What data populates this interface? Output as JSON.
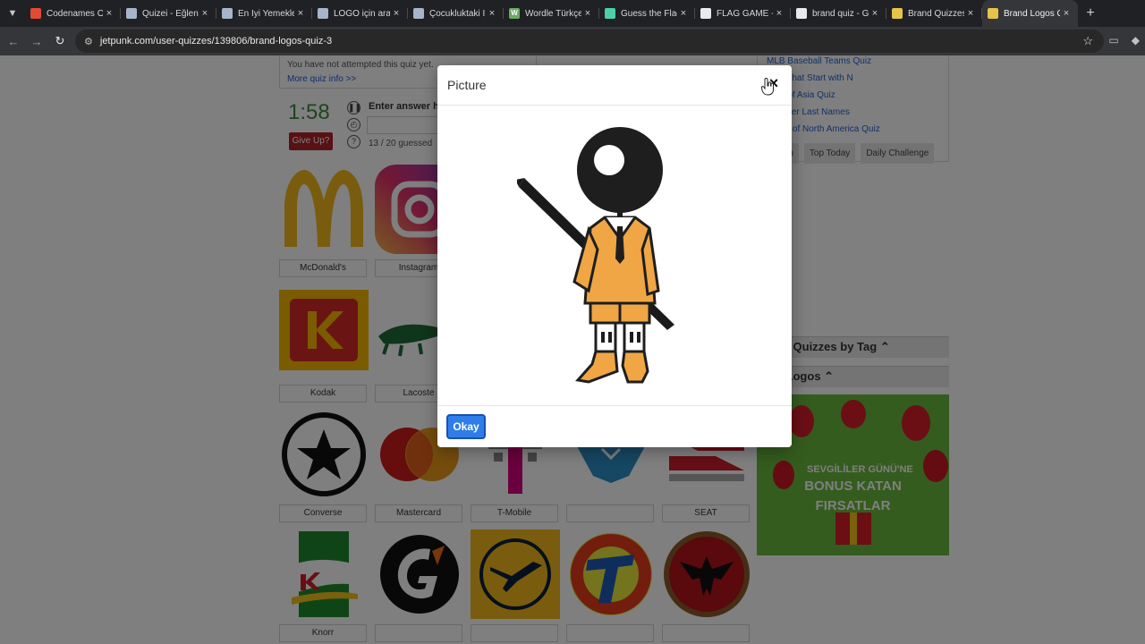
{
  "browser": {
    "tabs": [
      {
        "title": "Codenames O",
        "favicon_color": "#e34a33",
        "active": false
      },
      {
        "title": "Quizei - Eğlenc",
        "favicon_color": "#a6b5c9",
        "active": false
      },
      {
        "title": "En İyi Yemekle",
        "favicon_color": "#a6b5c9",
        "active": false
      },
      {
        "title": "LOGO için aran",
        "favicon_color": "#a6b5c9",
        "active": false
      },
      {
        "title": "Çocukluktaki İ",
        "favicon_color": "#a6b5c9",
        "active": false
      },
      {
        "title": "Wordle Türkçe",
        "favicon_color": "#6aaa64",
        "favicon_letter": "W",
        "active": false
      },
      {
        "title": "Guess the Flag",
        "favicon_color": "#4dd0a6",
        "active": false
      },
      {
        "title": "FLAG GAME - ",
        "favicon_color": "#e8eaed",
        "active": false
      },
      {
        "title": "brand quiz - G",
        "favicon_color": "#e8eaed",
        "active": false
      },
      {
        "title": "Brand Quizzes",
        "favicon_color": "#e6c34a",
        "active": false
      },
      {
        "title": "Brand Logos Q",
        "favicon_color": "#e6c34a",
        "active": true
      }
    ],
    "url": "jetpunk.com/user-quizzes/139806/brand-logos-quiz-3"
  },
  "quiz": {
    "not_attempted": "You have not attempted this quiz yet.",
    "more_info": "More quiz info >>",
    "timer": "1:58",
    "give_up": "Give Up?",
    "answer_label": "Enter answer h",
    "guessed": "13 / 20 guessed",
    "logos": [
      {
        "label": "McDonald's",
        "icon": "mcdonalds-logo"
      },
      {
        "label": "Instagram",
        "icon": "instagram-logo"
      },
      {
        "label": "Kodak",
        "icon": "kodak-logo"
      },
      {
        "label": "Lacoste",
        "icon": "lacoste-logo"
      },
      {
        "label": "Converse",
        "icon": "converse-logo"
      },
      {
        "label": "Mastercard",
        "icon": "mastercard-logo"
      },
      {
        "label": "T-Mobile",
        "icon": "tmobile-logo"
      },
      {
        "label": "",
        "icon": "bird-logo"
      },
      {
        "label": "SEAT",
        "icon": "seat-logo"
      },
      {
        "label": "Knorr",
        "icon": "knorr-logo"
      },
      {
        "label": "",
        "icon": "gatorade-logo"
      },
      {
        "label": "",
        "icon": "lufthansa-logo"
      },
      {
        "label": "",
        "icon": "t-brand-logo"
      },
      {
        "label": "",
        "icon": "bacardi-logo"
      }
    ]
  },
  "sidebar": {
    "links": [
      "MLB Baseball Teams Quiz",
      "…ies that Start with N",
      "…es of Asia Quiz",
      "…Potter Last Names",
      "…ries of North America Quiz"
    ],
    "tabs": [
      "…om",
      "Top Today",
      "Daily Challenge"
    ],
    "section1": "…lar Quizzes by Tag",
    "section2": "…d Logos",
    "ad_line1": "SEVGİLİLER GÜNÜ'NE",
    "ad_line2": "BONUS KATAN",
    "ad_line3": "FIRSATLAR"
  },
  "modal": {
    "title": "Picture",
    "close": "×",
    "okay": "Okay",
    "image_icon": "mascot-figure-icon"
  }
}
